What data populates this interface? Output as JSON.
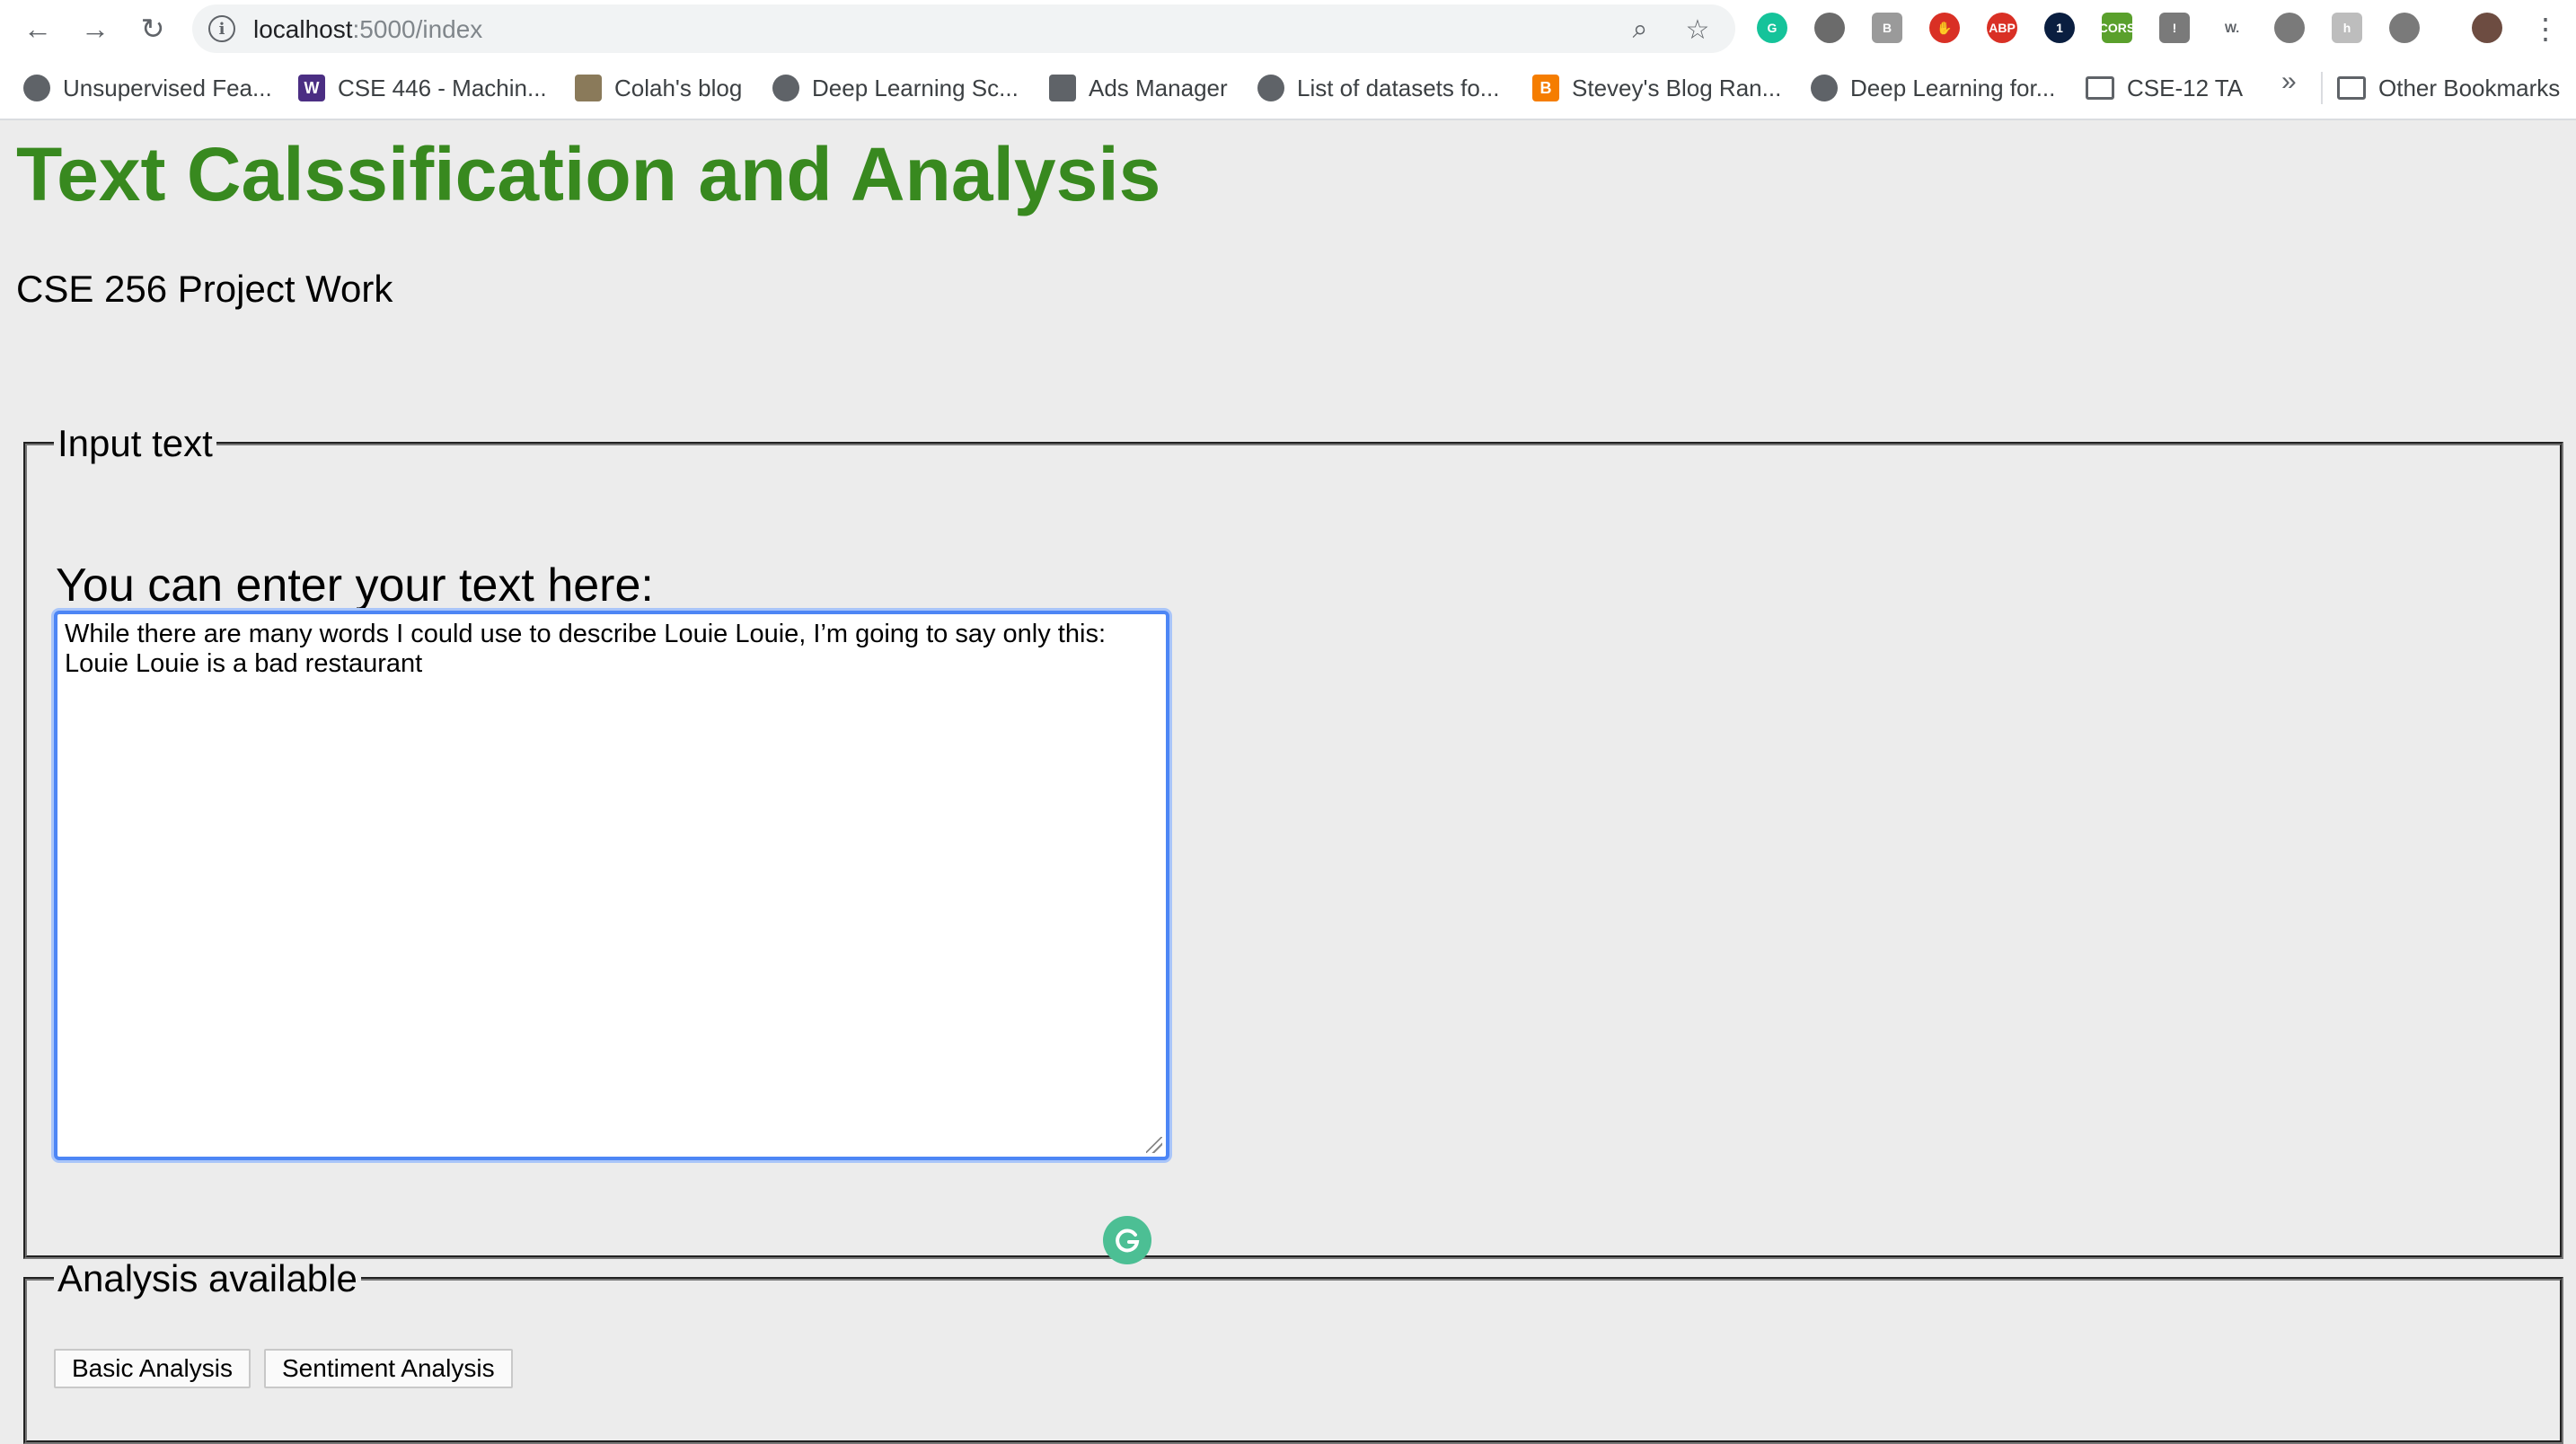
{
  "browser": {
    "url_host": "localhost",
    "url_rest": ":5000/index",
    "nav": {
      "back": "←",
      "forward": "→",
      "reload": "↻"
    },
    "zoom_icon": "⌕",
    "star_icon": "☆",
    "menu_icon": "⋮",
    "extensions": [
      {
        "name": "grammarly-extension-icon",
        "label": "G",
        "color": "#15c39a"
      },
      {
        "name": "film-extension-icon",
        "label": "",
        "color": "#6b6b6b"
      },
      {
        "name": "bi-extension-icon",
        "label": "B",
        "color": "#9a9a9a"
      },
      {
        "name": "stop-extension-icon",
        "label": "✋",
        "color": "#d93025"
      },
      {
        "name": "adblock-extension-icon",
        "label": "ABP",
        "color": "#d93025"
      },
      {
        "name": "onepassword-extension-icon",
        "label": "1",
        "color": "#0a1e40"
      },
      {
        "name": "cors-extension-icon",
        "label": "CORS",
        "color": "#5aa02c"
      },
      {
        "name": "network-extension-icon",
        "label": "!",
        "color": "#7a7a7a"
      },
      {
        "name": "w-extension-icon",
        "label": "W.",
        "color": "#ffffff"
      },
      {
        "name": "circle-extension-icon",
        "label": "",
        "color": "#7a7a7a"
      },
      {
        "name": "honey-extension-icon",
        "label": "h",
        "color": "#bdbdbd"
      },
      {
        "name": "cloud-extension-icon",
        "label": "",
        "color": "#7a7a7a"
      }
    ],
    "bookmarks": [
      {
        "label": "Unsupervised Fea...",
        "fav": "",
        "type": "globe"
      },
      {
        "label": "CSE 446 - Machin...",
        "fav": "W",
        "type": "uw"
      },
      {
        "label": "Colah's blog",
        "fav": "",
        "type": "colah"
      },
      {
        "label": "Deep Learning Sc...",
        "fav": "",
        "type": "globe"
      },
      {
        "label": "Ads Manager",
        "fav": "",
        "type": "ads"
      },
      {
        "label": "List of datasets fo...",
        "fav": "",
        "type": "globe"
      },
      {
        "label": "Stevey's Blog Ran...",
        "fav": "B",
        "type": "blogger"
      },
      {
        "label": "Deep Learning for...",
        "fav": "",
        "type": "globe"
      },
      {
        "label": "CSE-12 TA",
        "fav": "",
        "type": "folder"
      }
    ],
    "overflow": "»",
    "other_bookmarks": "Other Bookmarks"
  },
  "page": {
    "title": "Text Calssification and Analysis",
    "subtitle": "CSE 256 Project Work",
    "input_section": {
      "legend": "Input text",
      "prompt": "You can enter your text here:",
      "text_value": "While there are many words I could use to describe Louie Louie, I’m going to say only this: Louie Louie is a bad restaurant"
    },
    "analysis_section": {
      "legend": "Analysis available",
      "buttons": [
        "Basic Analysis",
        "Sentiment Analysis"
      ]
    }
  },
  "colors": {
    "title_green": "#38891f",
    "focus_blue": "#4d86f5",
    "grammarly_green": "#4cbf94"
  }
}
